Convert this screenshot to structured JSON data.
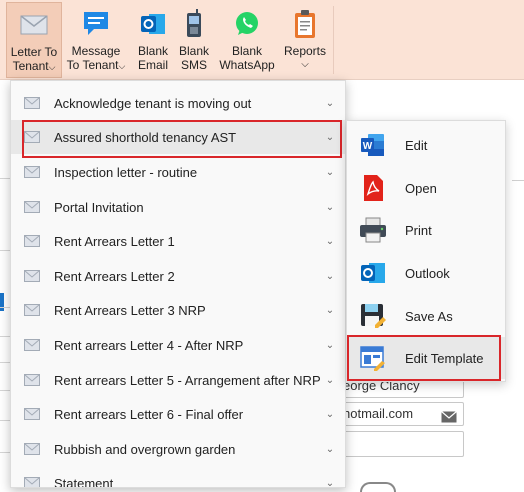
{
  "ribbon": {
    "buttons": [
      {
        "line1": "Letter To",
        "line2": "Tenant",
        "chevron": "⌵",
        "icon": "envelope-icon"
      },
      {
        "line1": "Message",
        "line2": "To Tenant",
        "chevron": "⌵",
        "icon": "chat-icon"
      },
      {
        "line1": "Blank",
        "line2": "Email",
        "icon": "outlook-icon"
      },
      {
        "line1": "Blank",
        "line2": "SMS",
        "icon": "phone-icon"
      },
      {
        "line1": "Blank",
        "line2": "WhatsApp",
        "icon": "whatsapp-icon"
      },
      {
        "line1": "Reports",
        "line2": "⌵",
        "icon": "clipboard-icon"
      }
    ]
  },
  "menu": {
    "items": [
      {
        "label": "Acknowledge tenant is moving out"
      },
      {
        "label": "Assured shorthold tenancy AST"
      },
      {
        "label": "Inspection letter - routine"
      },
      {
        "label": "Portal Invitation"
      },
      {
        "label": "Rent Arrears Letter 1"
      },
      {
        "label": "Rent Arrears Letter 2"
      },
      {
        "label": "Rent Arrears Letter 3 NRP"
      },
      {
        "label": "Rent arrears Letter 4 - After NRP"
      },
      {
        "label": "Rent arrears Letter 5 - Arrangement after NRP"
      },
      {
        "label": "Rent arrears Letter 6 - Final offer"
      },
      {
        "label": "Rubbish and overgrown garden"
      },
      {
        "label": "Statement"
      }
    ],
    "chevron": "⌄",
    "selected_index": 1
  },
  "submenu": {
    "items": [
      {
        "label": "Edit",
        "icon": "word-icon"
      },
      {
        "label": "Open",
        "icon": "pdf-icon"
      },
      {
        "label": "Print",
        "icon": "printer-icon"
      },
      {
        "label": "Outlook",
        "icon": "outlook-icon"
      },
      {
        "label": "Save As",
        "icon": "save-icon"
      },
      {
        "label": "Edit Template",
        "icon": "template-icon"
      }
    ],
    "selected_index": 5
  },
  "background": {
    "name_value": "eorge Clancy",
    "email_value": "hotmail.com"
  },
  "colors": {
    "ribbon_bg": "#fbe3d6",
    "highlight": "#d9262a",
    "word_blue": "#185abd",
    "pdf_red": "#e2231a",
    "whatsapp_green": "#25d366"
  }
}
